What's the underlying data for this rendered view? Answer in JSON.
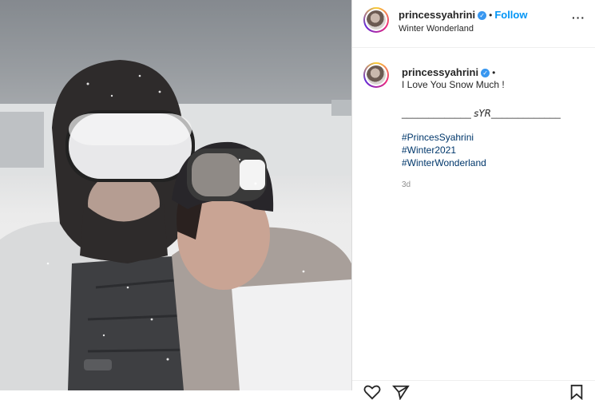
{
  "header": {
    "username": "princessyahrini",
    "follow_label": "Follow",
    "location": "Winter Wonderland",
    "more_icon": "more-horizontal-icon"
  },
  "caption": {
    "username": "princessyahrini",
    "text": "I Love You Snow Much !",
    "signature": "_____________ 𝘴𝘠𝘙_____________",
    "hashtags": [
      "#PrincesSyahrini",
      "#Winter2021",
      "#WinterWonderland"
    ],
    "time": "3d"
  },
  "icons": {
    "verified": "verified-badge-icon",
    "like": "heart-icon",
    "share": "send-icon",
    "save": "bookmark-icon"
  },
  "colors": {
    "follow": "#0095f6",
    "verified": "#3897f0",
    "hashtag": "#00376b"
  }
}
